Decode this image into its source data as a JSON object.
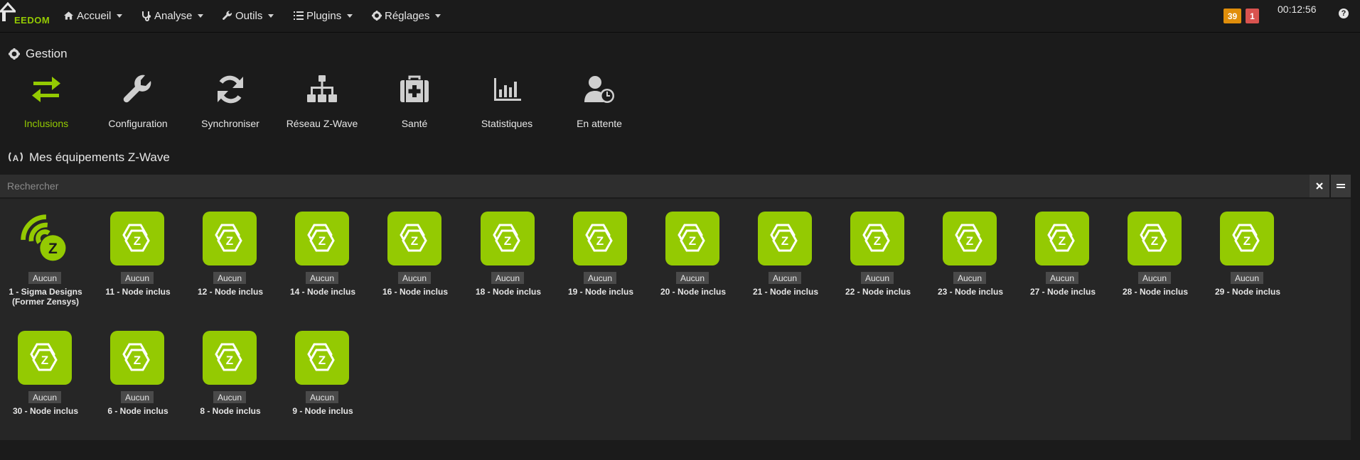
{
  "brand": {
    "logo_text": "EEDOM",
    "accent": "#94ca02"
  },
  "nav": {
    "items": [
      {
        "label": "Accueil",
        "icon": "home-icon"
      },
      {
        "label": "Analyse",
        "icon": "stethoscope-icon"
      },
      {
        "label": "Outils",
        "icon": "wrench-icon"
      },
      {
        "label": "Plugins",
        "icon": "list-icon"
      },
      {
        "label": "Réglages",
        "icon": "gear-icon"
      }
    ],
    "badge_warning": "39",
    "badge_warning_color": "#e08e0b",
    "badge_danger": "1",
    "badge_danger_color": "#d9534f",
    "clock": "00:12:56",
    "help_icon": "question-icon"
  },
  "gestion": {
    "title": "Gestion",
    "cards": [
      {
        "label": "Inclusions",
        "icon": "exchange-icon",
        "active": true
      },
      {
        "label": "Configuration",
        "icon": "wrench-icon"
      },
      {
        "label": "Synchroniser",
        "icon": "refresh-icon"
      },
      {
        "label": "Réseau Z-Wave",
        "icon": "sitemap-icon"
      },
      {
        "label": "Santé",
        "icon": "medkit-icon"
      },
      {
        "label": "Statistiques",
        "icon": "bar-chart-icon"
      },
      {
        "label": "En attente",
        "icon": "user-clock-icon"
      }
    ]
  },
  "equipments": {
    "title": "Mes équipements Z-Wave",
    "search_placeholder": "Rechercher",
    "items": [
      {
        "object": "Aucun",
        "name": "1 - Sigma Designs (Former Zensys)",
        "icon": "zwave-controller-icon"
      },
      {
        "object": "Aucun",
        "name": "11 - Node inclus",
        "icon": "zwave-node-icon"
      },
      {
        "object": "Aucun",
        "name": "12 - Node inclus",
        "icon": "zwave-node-icon"
      },
      {
        "object": "Aucun",
        "name": "14 - Node inclus",
        "icon": "zwave-node-icon"
      },
      {
        "object": "Aucun",
        "name": "16 - Node inclus",
        "icon": "zwave-node-icon"
      },
      {
        "object": "Aucun",
        "name": "18 - Node inclus",
        "icon": "zwave-node-icon"
      },
      {
        "object": "Aucun",
        "name": "19 - Node inclus",
        "icon": "zwave-node-icon"
      },
      {
        "object": "Aucun",
        "name": "20 - Node inclus",
        "icon": "zwave-node-icon"
      },
      {
        "object": "Aucun",
        "name": "21 - Node inclus",
        "icon": "zwave-node-icon"
      },
      {
        "object": "Aucun",
        "name": "22 - Node inclus",
        "icon": "zwave-node-icon"
      },
      {
        "object": "Aucun",
        "name": "23 - Node inclus",
        "icon": "zwave-node-icon"
      },
      {
        "object": "Aucun",
        "name": "27 - Node inclus",
        "icon": "zwave-node-icon"
      },
      {
        "object": "Aucun",
        "name": "28 - Node inclus",
        "icon": "zwave-node-icon"
      },
      {
        "object": "Aucun",
        "name": "29 - Node inclus",
        "icon": "zwave-node-icon"
      },
      {
        "object": "Aucun",
        "name": "30 - Node inclus",
        "icon": "zwave-node-icon"
      },
      {
        "object": "Aucun",
        "name": "6 - Node inclus",
        "icon": "zwave-node-icon"
      },
      {
        "object": "Aucun",
        "name": "8 - Node inclus",
        "icon": "zwave-node-icon"
      },
      {
        "object": "Aucun",
        "name": "9 - Node inclus",
        "icon": "zwave-node-icon"
      }
    ]
  }
}
